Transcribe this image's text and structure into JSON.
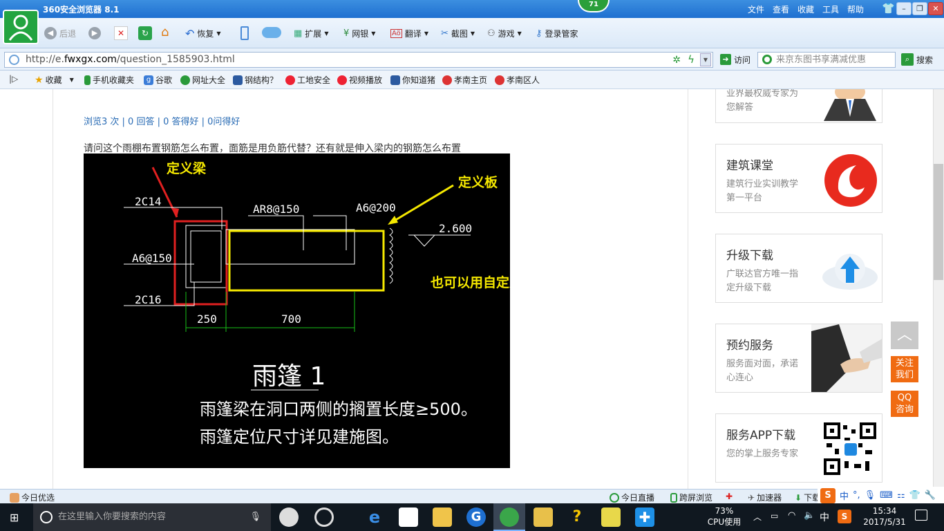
{
  "browser": {
    "title": "360安全浏览器 8.1",
    "notification_count": "71",
    "menu": [
      "文件",
      "查看",
      "收藏",
      "工具",
      "帮助"
    ],
    "window_controls": {
      "minimize": "–",
      "maximize": "❐",
      "close": "✕"
    }
  },
  "toolbar": {
    "back_label": "后退",
    "restore_label": "恢复",
    "items": [
      "扩展",
      "网银",
      "翻译",
      "截图",
      "游戏",
      "登录管家"
    ]
  },
  "address": {
    "url_prefix": "http://e.",
    "url_domain": "fwxgx.com",
    "url_path": "/question_1585903.html",
    "visit_label": "访问",
    "search_placeholder": "来京东图书享满减优惠",
    "search_button": "搜索"
  },
  "favorites": [
    "收藏",
    "手机收藏夹",
    "谷歌",
    "网址大全",
    "钢结构？",
    "工地安全",
    "视频播放",
    "你知道猪",
    "孝南主页",
    "孝南区人"
  ],
  "question": {
    "stats": "浏览3 次 | 0 回答 | 0 答得好 | 0问得好",
    "text": "请问这个雨棚布置钢筋怎么布置，面筋是用负筋代替？还有就是伸入梁内的钢筋怎么布置"
  },
  "drawing": {
    "label_beam": "定义梁",
    "label_slab": "定义板",
    "label_custom": "也可以用自定义线定义",
    "rebar_top": "2C14",
    "rebar_stirrup": "A6@150",
    "rebar_bottom": "2C16",
    "rebar_slab_main": "AR8@150",
    "rebar_slab_dist": "A6@200",
    "elevation": "2.600",
    "dim_beam": "250",
    "dim_slab": "700",
    "caption_title": "雨篷 1",
    "note_line1": "雨篷梁在洞口两侧的搁置长度≥500。",
    "note_line2": "雨篷定位尺寸详见建施图。"
  },
  "sidebar": [
    {
      "title": "",
      "desc": "业界最权威专家为您解答"
    },
    {
      "title": "建筑课堂",
      "desc": "建筑行业实训教学第一平台"
    },
    {
      "title": "升级下载",
      "desc": "广联达官方唯一指定升级下载"
    },
    {
      "title": "预约服务",
      "desc": "服务面对面，承诺心连心"
    },
    {
      "title": "服务APP下载",
      "desc": "您的掌上服务专家"
    }
  ],
  "float_buttons": {
    "follow": "关注我们",
    "qq": "QQ咨询"
  },
  "status": {
    "left": "今日优选",
    "items": [
      "今日直播",
      "跨屏浏览",
      "加速器",
      "下载"
    ]
  },
  "taskbar": {
    "search_placeholder": "在这里输入你要搜索的内容",
    "cpu_percent": "73%",
    "cpu_label": "CPU使用",
    "ime": "中",
    "time": "15:34",
    "date": "2017/5/31"
  },
  "colors": {
    "accent": "#1e6fd0",
    "green": "#23a440",
    "orange": "#f06b12",
    "cad_red": "#e02020",
    "cad_yellow": "#f5e800"
  }
}
